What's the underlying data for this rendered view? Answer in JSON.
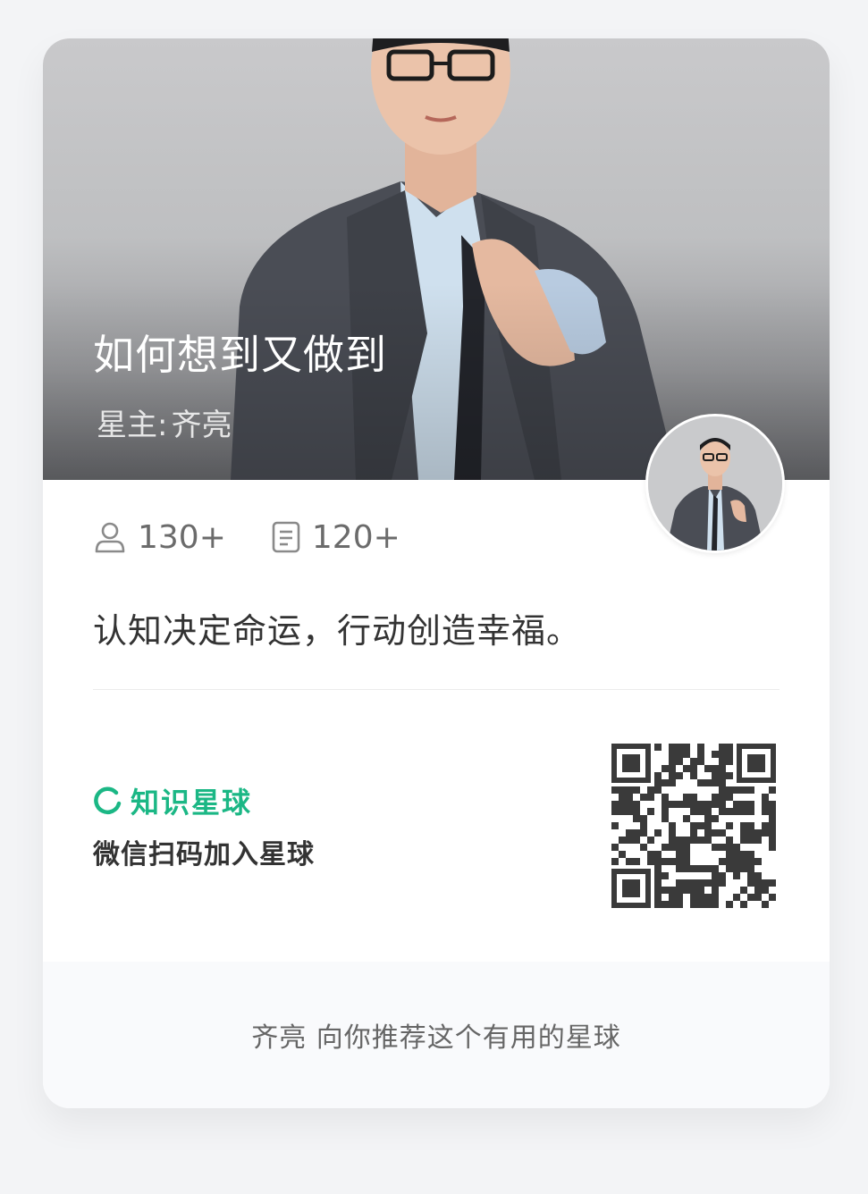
{
  "hero": {
    "title": "如何想到又做到",
    "owner_prefix": "星主:",
    "owner_name": "齐亮"
  },
  "stats": {
    "members": "130+",
    "posts": "120+"
  },
  "description": "认知决定命运，行动创造幸福。",
  "brand": {
    "name": "知识星球",
    "scan_text": "微信扫码加入星球",
    "accent_color": "#1bb785"
  },
  "footer": {
    "recommend_text": "齐亮 向你推荐这个有用的星球"
  }
}
